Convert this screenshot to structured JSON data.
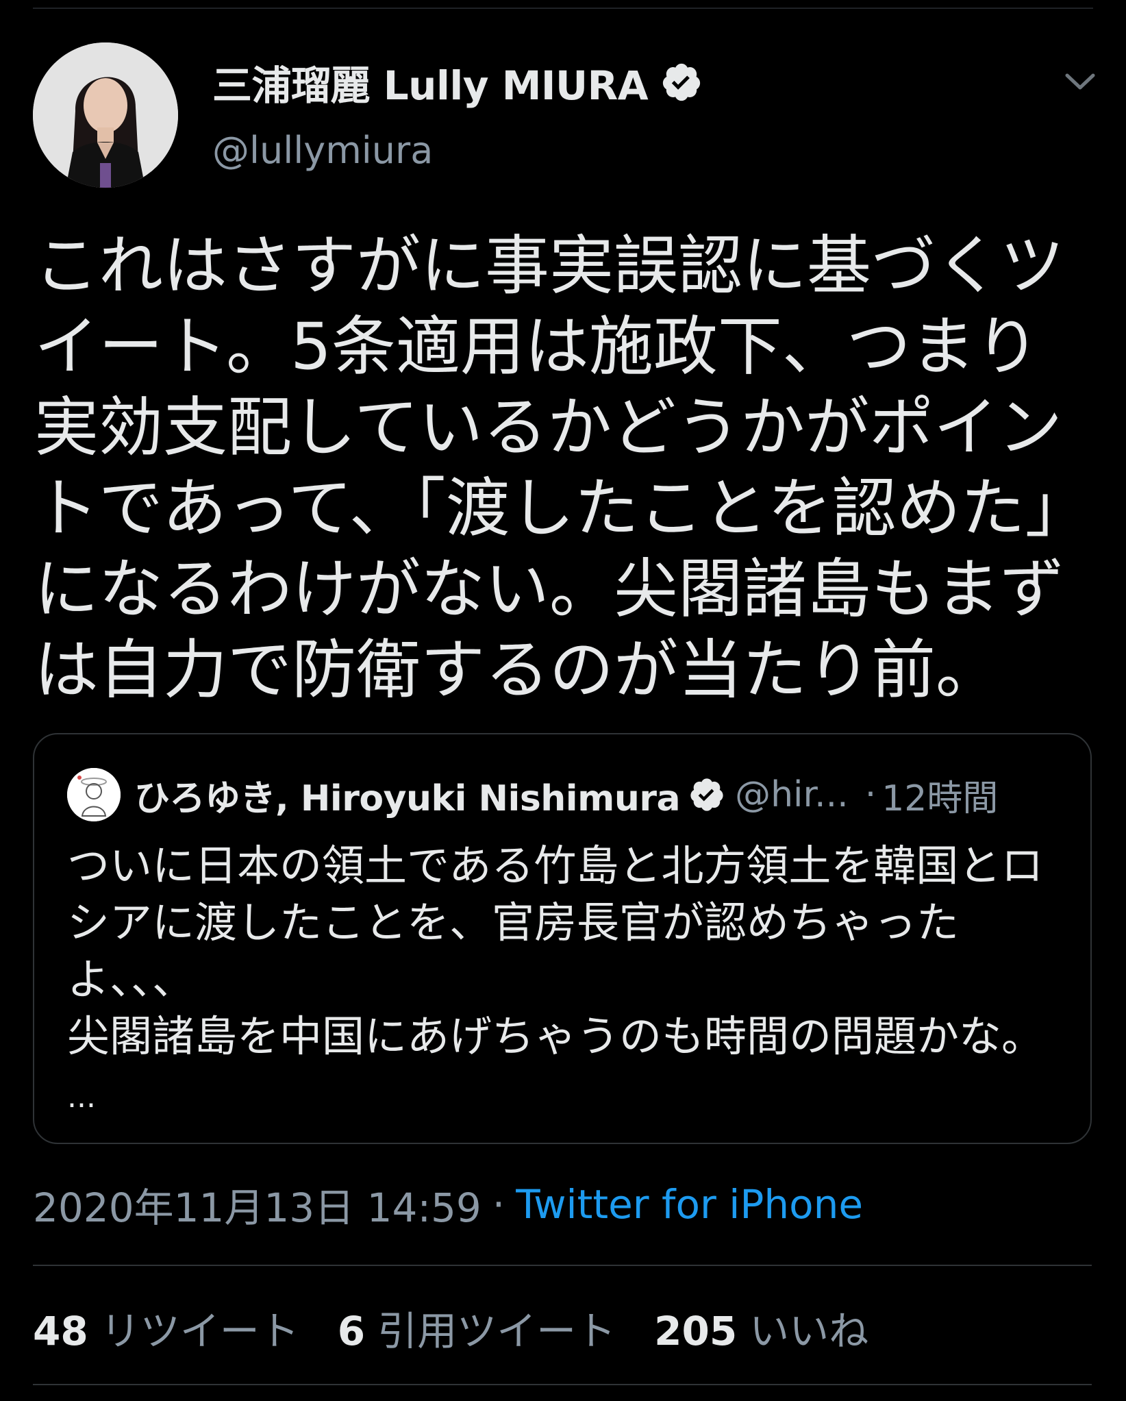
{
  "author": {
    "display_name": "三浦瑠麗 Lully MIURA",
    "handle": "@lullymiura",
    "avatar_icon": "author-avatar",
    "verified_icon": "verified-badge-icon"
  },
  "menu_icon": "chevron-down-icon",
  "tweet": {
    "text": "これはさすがに事実誤認に基づくツイート。5条適用は施政下、つまり実効支配しているかどうかがポイントであって、「渡したことを認めた」になるわけがない。尖閣諸島もまずは自力で防衛するのが当たり前。"
  },
  "quote": {
    "display_name": "ひろゆき, Hiroyuki Nishimura",
    "handle": "@hir...",
    "separator": "·",
    "time": "12時間",
    "text": "ついに日本の領土である竹島と北方領土を韓国とロシアに渡したことを、官房長官が認めちゃったよ、、、\n尖閣諸島を中国にあげちゃうのも時間の問題かな。",
    "more": "..."
  },
  "meta": {
    "date": "2020年11月13日 14:59",
    "separator": "·",
    "source": "Twitter for iPhone"
  },
  "stats": [
    {
      "count": "48",
      "label": "リツイート"
    },
    {
      "count": "6",
      "label": "引用ツイート"
    },
    {
      "count": "205",
      "label": "いいね"
    }
  ],
  "colors": {
    "background": "#000000",
    "text": "#e7e9ea",
    "muted": "#8b98a5",
    "link": "#1d9bf0",
    "border": "#2f3336"
  }
}
